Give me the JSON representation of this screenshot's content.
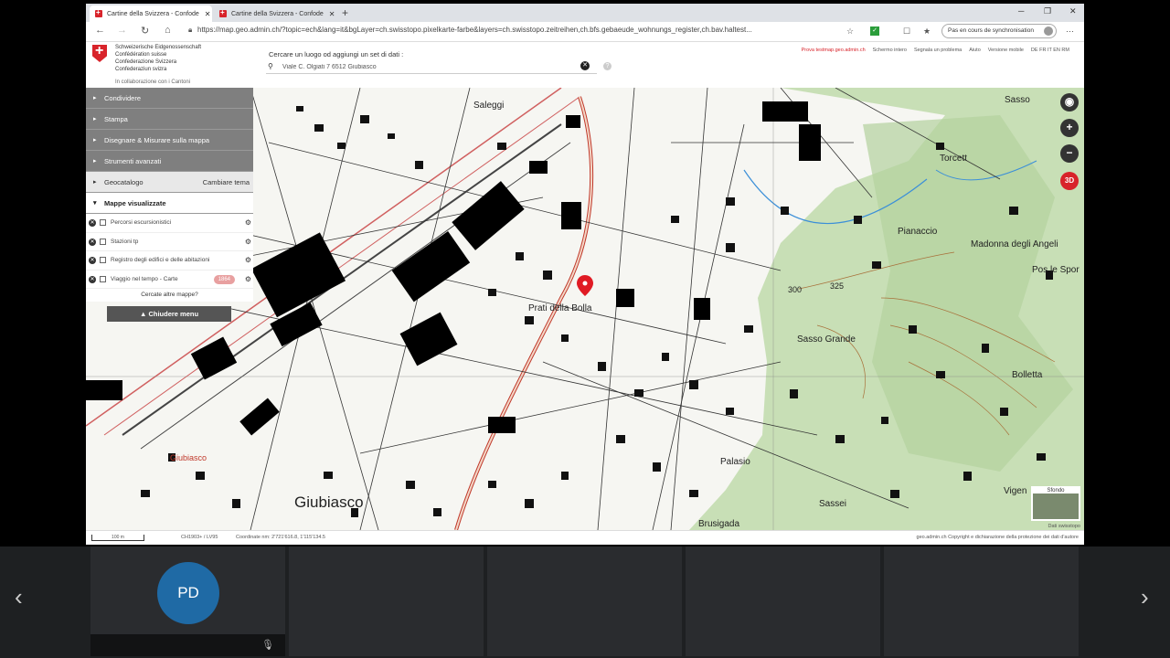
{
  "browser": {
    "tabs": [
      {
        "title": "Cartine della Svizzera - Confode"
      },
      {
        "title": "Cartine della Svizzera - Confode"
      }
    ],
    "url": "https://map.geo.admin.ch/?topic=ech&lang=it&bgLayer=ch.swisstopo.pixelkarte-farbe&layers=ch.swisstopo.zeitreihen,ch.bfs.gebaeude_wohnungs_register,ch.bav.haltest...",
    "sync_label": "Pas en cours de synchronisation"
  },
  "header": {
    "federation": [
      "Schweizerische Eidgenossenschaft",
      "Confédération suisse",
      "Confederazione Svizzera",
      "Confederaziun svizra"
    ],
    "cooperation": "In collaborazione con i Cantoni",
    "search_label": "Cercare un luogo od aggiungi un set di dati :",
    "search_value": "Viale C. Olgiati 7 6512 Giubiasco",
    "links": {
      "test": "Prova testmap.geo.admin.ch",
      "fullscreen": "Schermo intero",
      "report": "Segnala un problema",
      "help": "Aiuto",
      "mobile": "Versione mobile",
      "langs": "DE FR IT EN RM"
    }
  },
  "menu": {
    "share": "Condividere",
    "print": "Stampa",
    "draw": "Disegnare & Misurare sulla mappa",
    "tools": "Strumenti avanzati",
    "catalog": "Geocatalogo",
    "change_theme": "Cambiare tema",
    "displayed": "Mappe visualizzate",
    "layers": [
      {
        "label": "Percorsi escursionistici",
        "badge": ""
      },
      {
        "label": "Stazioni tp",
        "badge": ""
      },
      {
        "label": "Registro degli edifici e delle abitazioni",
        "badge": ""
      },
      {
        "label": "Viaggio nel tempo - Carte",
        "badge": "1864"
      }
    ],
    "more_maps": "Cercate altre mappe?",
    "close_menu": "Chiudere menu"
  },
  "map": {
    "places": {
      "saleggi": "Saleggi",
      "sasso": "Sasso",
      "torcett": "Torcett",
      "pianaccio": "Pianaccio",
      "madonna": "Madonna degli Angeli",
      "pos_le_spor": "Pos le Spor",
      "prati": "Prati della Bolla",
      "sasso_grande": "Sasso Grande",
      "bolletta": "Bolletta",
      "palasio": "Palasio",
      "giubiasco_station": "Giubiasco",
      "giubiasco": "Giubiasco",
      "sassei": "Sassei",
      "vigen": "Vigen",
      "brusigada": "Brusigada",
      "h300": "300",
      "h325": "325"
    },
    "controls": {
      "zoom_in": "+",
      "zoom_out": "−",
      "view3d": "3D"
    },
    "bg_switch": "Sfondo",
    "data_source": "Dati swisstopo"
  },
  "statusbar": {
    "scale": "100 m",
    "crs": "CH1903+ / LV95",
    "coords": "Coordinate nm: 2'721'616.8, 1'115'134.5",
    "copyright": "geo.admin.ch     Copyright e dichiarazione della protezione dei dati d'autore"
  },
  "meeting": {
    "participant_initials": "PD"
  },
  "colors": {
    "accent": "#d8232a",
    "avatar": "#1f6aa5",
    "menu": "#7f7f7f"
  }
}
